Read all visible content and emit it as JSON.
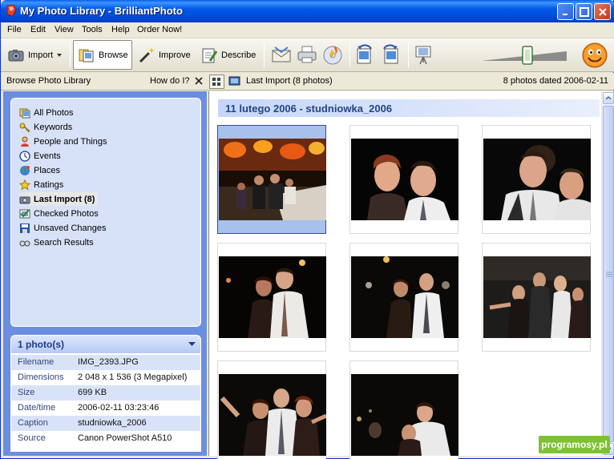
{
  "window": {
    "title": "My Photo Library - BrilliantPhoto"
  },
  "menu": [
    {
      "label": "File",
      "name": "menu-file"
    },
    {
      "label": "Edit",
      "name": "menu-edit"
    },
    {
      "label": "View",
      "name": "menu-view"
    },
    {
      "label": "Tools",
      "name": "menu-tools"
    },
    {
      "label": "Help",
      "name": "menu-help"
    },
    {
      "label": "Order Now!",
      "name": "menu-order-now"
    }
  ],
  "toolbar": {
    "import_label": "Import",
    "browse_label": "Browse",
    "improve_label": "Improve",
    "describe_label": "Describe",
    "zoom_level": 0.72,
    "icons": [
      "email-icon",
      "print-icon",
      "burn-cd-icon",
      "rotate-left-icon",
      "rotate-right-icon",
      "slideshow-icon",
      "smiley-icon"
    ]
  },
  "navbar": {
    "browse_label": "Browse Photo Library",
    "howdoi_label": "How do I?",
    "view_label": "Last Import (8 photos)",
    "status": "8 photos dated 2006-02-11"
  },
  "sidebar": {
    "items": [
      {
        "label": "All Photos",
        "icon": "photos-icon",
        "selected": false
      },
      {
        "label": "Keywords",
        "icon": "keywords-icon",
        "selected": false
      },
      {
        "label": "People and Things",
        "icon": "people-icon",
        "selected": false
      },
      {
        "label": "Events",
        "icon": "events-icon",
        "selected": false
      },
      {
        "label": "Places",
        "icon": "globe-icon",
        "selected": false
      },
      {
        "label": "Ratings",
        "icon": "star-icon",
        "selected": false
      },
      {
        "label": "Last Import (8)",
        "icon": "import-icon",
        "selected": true
      },
      {
        "label": "Checked Photos",
        "icon": "checked-icon",
        "selected": false
      },
      {
        "label": "Unsaved Changes",
        "icon": "save-icon",
        "selected": false
      },
      {
        "label": "Search Results",
        "icon": "search-icon",
        "selected": false
      }
    ]
  },
  "info": {
    "header": "1 photo(s)",
    "rows": [
      {
        "key": "Filename",
        "value": "IMG_2393.JPG"
      },
      {
        "key": "Dimensions",
        "value": "2 048 x 1 536 (3 Megapixel)"
      },
      {
        "key": "Size",
        "value": "699 KB"
      },
      {
        "key": "Date/time",
        "value": "2006-02-11 03:23:46"
      },
      {
        "key": "Caption",
        "value": "studniowka_2006"
      },
      {
        "key": "Source",
        "value": "Canon PowerShot A510"
      }
    ]
  },
  "gallery": {
    "group_title": "11 lutego 2006 - studniowka_2006",
    "photo_count": 8,
    "selected_index": 0
  },
  "watermark": "programosy.pl"
}
